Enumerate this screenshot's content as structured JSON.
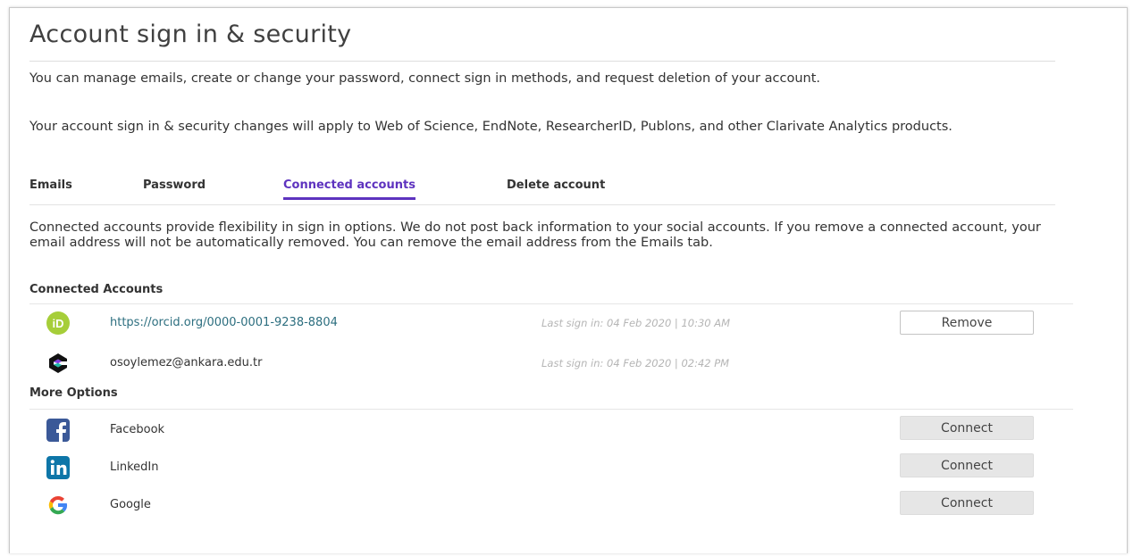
{
  "page": {
    "title": "Account sign in & security",
    "intro_1": "You can manage emails, create or change your password, connect sign in methods, and request deletion of your account.",
    "intro_2": "Your account sign in & security changes will apply to Web of Science, EndNote, ResearcherID, Publons, and other Clarivate Analytics products."
  },
  "tabs": [
    {
      "label": "Emails",
      "active": false
    },
    {
      "label": "Password",
      "active": false
    },
    {
      "label": "Connected accounts",
      "active": true
    },
    {
      "label": "Delete account",
      "active": false
    }
  ],
  "connected_tab": {
    "description": "Connected accounts provide flexibility in sign in options. We do not post back information to your social accounts. If you remove a connected account, your email address will not be automatically removed. You can remove the email address from the Emails tab.",
    "connected_heading": "Connected Accounts",
    "connected": [
      {
        "icon": "orcid-icon",
        "label": "https://orcid.org/0000-0001-9238-8804",
        "last_sign_in": "Last sign in: 04 Feb 2020 | 10:30 AM",
        "action": "Remove"
      },
      {
        "icon": "clarivate-icon",
        "label": "osoylemez@ankara.edu.tr",
        "last_sign_in": "Last sign in: 04 Feb 2020 | 02:42 PM"
      }
    ],
    "more_heading": "More Options",
    "more": [
      {
        "icon": "facebook-icon",
        "label": "Facebook",
        "action": "Connect"
      },
      {
        "icon": "linkedin-icon",
        "label": "LinkedIn",
        "action": "Connect"
      },
      {
        "icon": "google-icon",
        "label": "Google",
        "action": "Connect"
      }
    ]
  },
  "colors": {
    "accent": "#5e33bf",
    "link": "#2c6e7f",
    "orcid": "#a6ce39",
    "facebook": "#3b5998",
    "linkedin": "#0e76a8"
  }
}
